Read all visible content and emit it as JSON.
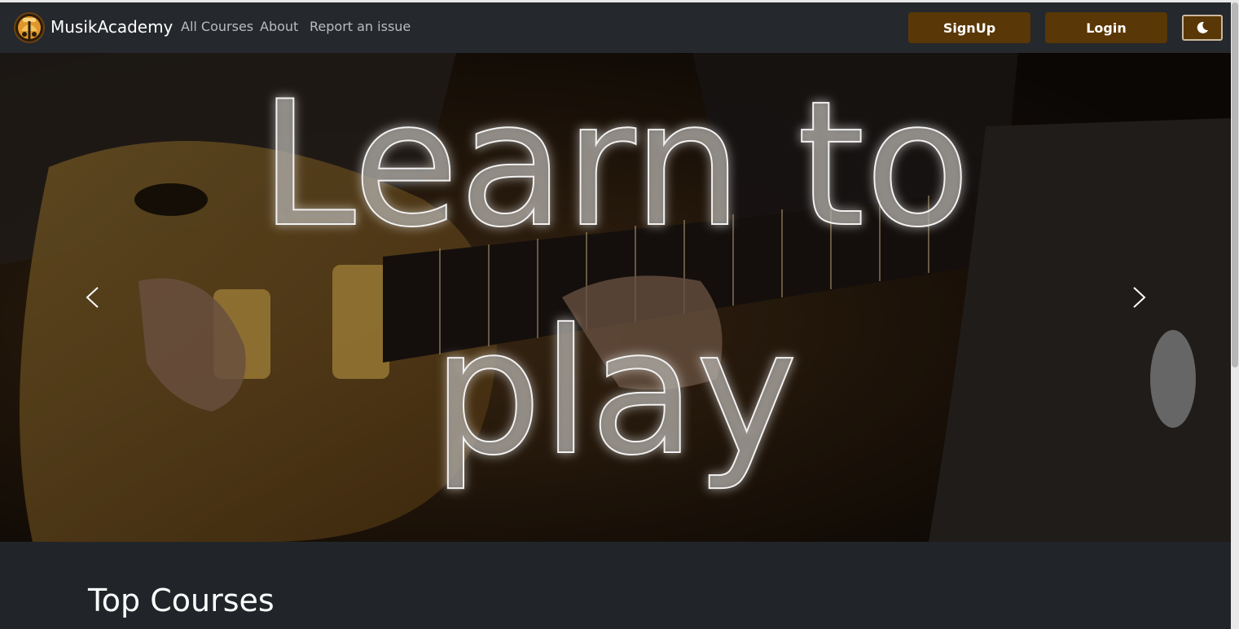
{
  "navbar": {
    "brand": "MusikAcademy",
    "links": {
      "all_courses": "All Courses",
      "about": "About",
      "report": "Report an issue"
    },
    "signup_label": "SignUp",
    "login_label": "Login",
    "theme_toggle_icon": "moon-icon"
  },
  "hero": {
    "line1": "Learn to",
    "line2": "play",
    "prev_icon": "chevron-left-icon",
    "next_icon": "chevron-right-icon"
  },
  "section": {
    "title": "Top Courses"
  },
  "colors": {
    "accent_button": "#5a3706",
    "navbar_bg": "#25282c",
    "page_bg": "#212529"
  }
}
